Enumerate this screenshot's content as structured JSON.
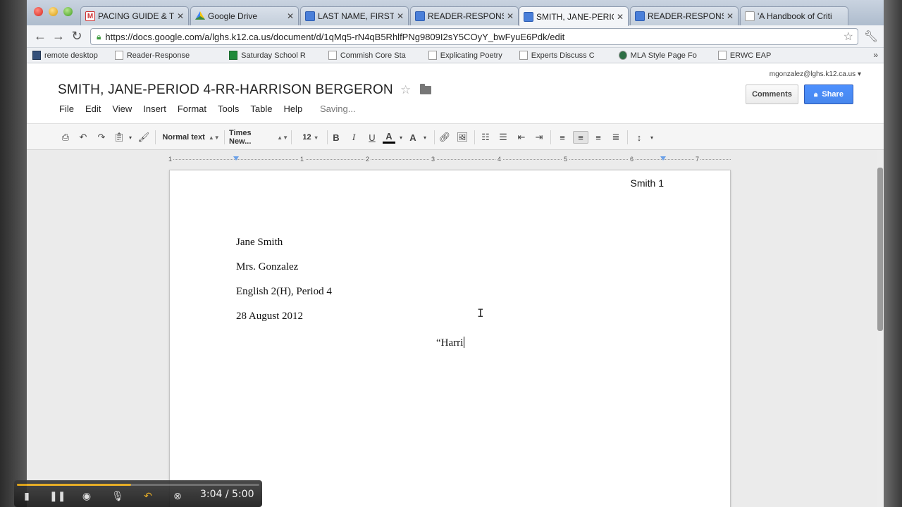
{
  "browser": {
    "tabs": [
      {
        "label": "PACING GUIDE & TEA",
        "icon": "gmail-icon"
      },
      {
        "label": "Google Drive",
        "icon": "drive-icon"
      },
      {
        "label": "LAST NAME, FIRST N",
        "icon": "doc-icon"
      },
      {
        "label": "READER-RESPONSE-S",
        "icon": "doc-icon"
      },
      {
        "label": "SMITH, JANE-PERIOD",
        "icon": "doc-icon",
        "active": true
      },
      {
        "label": "READER-RESPONSE-S",
        "icon": "doc-icon"
      },
      {
        "label": "'A Handbook of Criti",
        "icon": "page-icon"
      }
    ],
    "url": "https://docs.google.com/a/lghs.k12.ca.us/document/d/1qMq5-rN4qB5RhlfPNg9809I2sY5COyY_bwFyuE6Pdk/edit",
    "bookmarks": [
      {
        "label": "remote desktop",
        "icon": "remote-desktop-icon"
      },
      {
        "label": "Reader-Response",
        "icon": "page-icon"
      },
      {
        "label": "Saturday School R",
        "icon": "sheet-icon"
      },
      {
        "label": "Commish Core Sta",
        "icon": "page-icon"
      },
      {
        "label": "Explicating Poetry",
        "icon": "page-icon"
      },
      {
        "label": "Experts Discuss C",
        "icon": "page-icon"
      },
      {
        "label": "MLA Style Page Fo",
        "icon": "seal-icon"
      },
      {
        "label": "ERWC EAP",
        "icon": "page-icon"
      }
    ]
  },
  "docs": {
    "account": "mgonzalez@lghs.k12.ca.us",
    "title": "SMITH, JANE-PERIOD 4-RR-HARRISON BERGERON",
    "menu": [
      "File",
      "Edit",
      "View",
      "Insert",
      "Format",
      "Tools",
      "Table",
      "Help"
    ],
    "status": "Saving...",
    "comments_label": "Comments",
    "share_label": "Share"
  },
  "toolbar": {
    "style": "Normal text",
    "font": "Times New...",
    "size": "12",
    "bold": "B",
    "italic": "I",
    "underline": "U",
    "text_color_glyph": "A",
    "highlight_glyph": "A"
  },
  "ruler": {
    "numbers": [
      "1",
      "1",
      "2",
      "3",
      "4",
      "5",
      "6",
      "7"
    ]
  },
  "document": {
    "header": "Smith 1",
    "lines": [
      "Jane Smith",
      "Mrs. Gonzalez",
      "English 2(H), Period 4",
      "28 August 2012"
    ],
    "typing": "“Harri"
  },
  "player": {
    "time": "3:04 / 5:00",
    "progress": 0.47
  }
}
